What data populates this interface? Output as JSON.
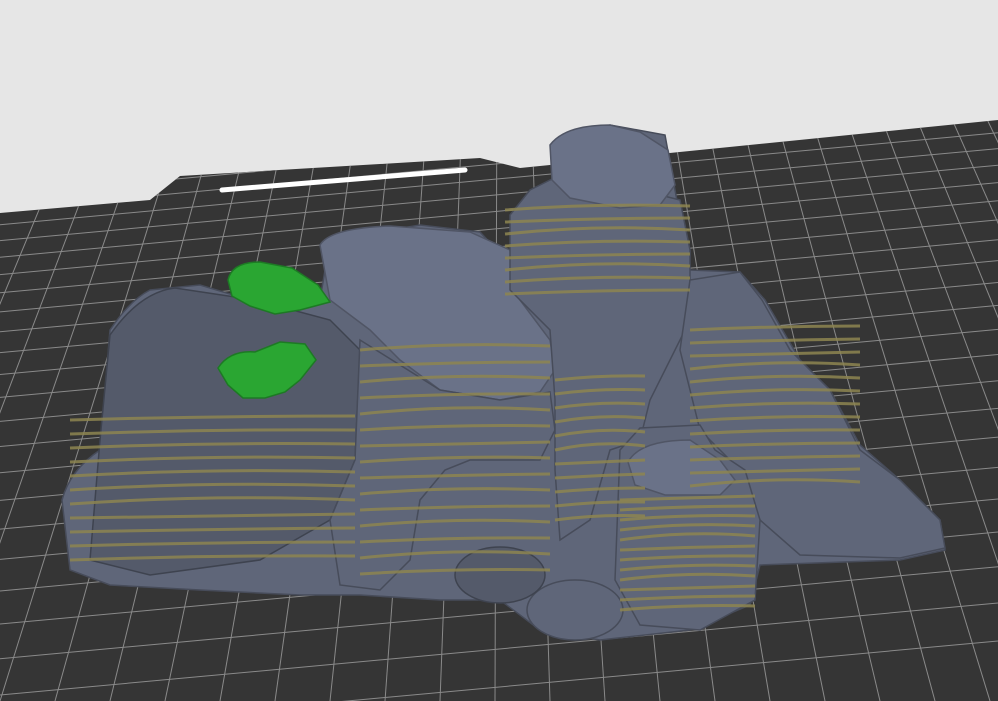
{
  "viewport": {
    "background_color": "#e6e6e6",
    "bed_color": "#353535",
    "bed_grid_color": "#8a8a8a",
    "bed_handle_color": "#ffffff"
  },
  "model": {
    "parts": [
      {
        "name": "rock-formation",
        "color": "#5f6679",
        "stripe_color": "#8d8550"
      },
      {
        "name": "moss",
        "color": "#2aa632"
      }
    ]
  }
}
